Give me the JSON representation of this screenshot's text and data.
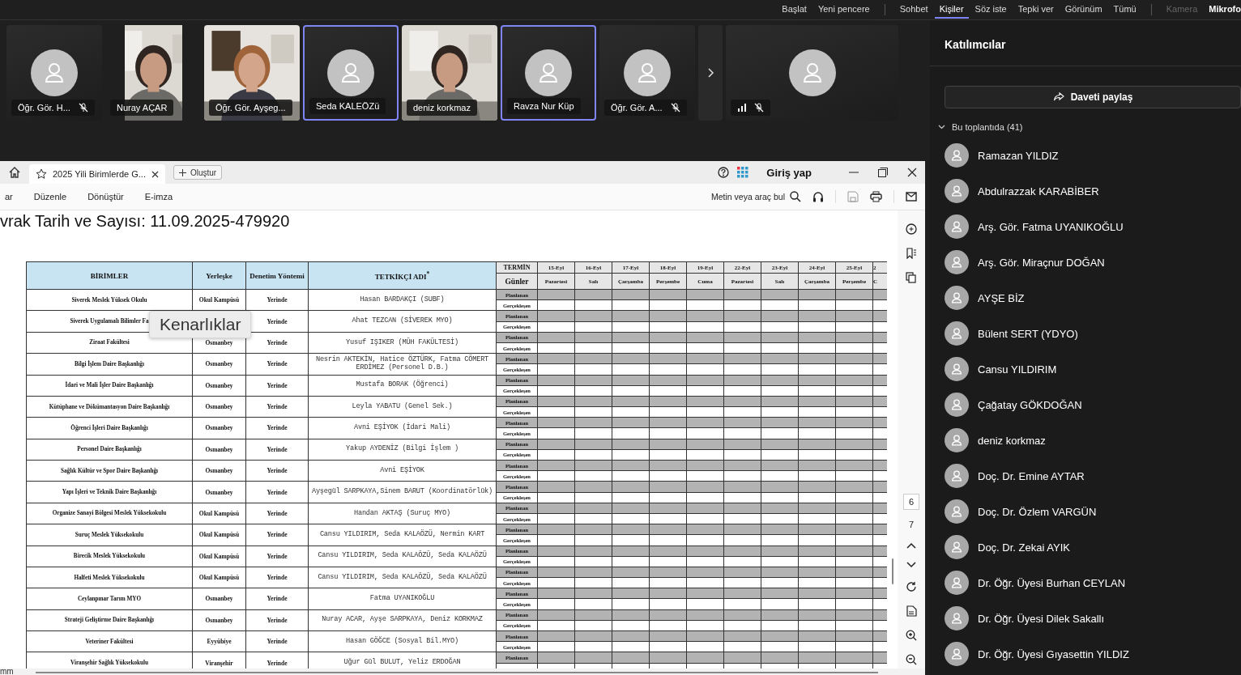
{
  "top_menu": [
    [
      {
        "label": "Başlat",
        "selected": false,
        "disabled": false
      },
      {
        "label": "Yeni pencere",
        "selected": false,
        "disabled": false
      }
    ],
    [
      {
        "label": "Sohbet",
        "selected": false,
        "disabled": false
      },
      {
        "label": "Kişiler",
        "selected": true,
        "disabled": false
      },
      {
        "label": "Söz iste",
        "selected": false,
        "disabled": false
      },
      {
        "label": "Tepki ver",
        "selected": false,
        "disabled": false
      },
      {
        "label": "Görünüm",
        "selected": false,
        "disabled": false
      },
      {
        "label": "Tümü",
        "selected": false,
        "disabled": false
      }
    ],
    [
      {
        "label": "Kamera",
        "selected": false,
        "disabled": true
      },
      {
        "label": "Mikrofo",
        "selected": false,
        "disabled": false
      }
    ]
  ],
  "video_tiles": [
    {
      "kind": "avatar",
      "name": "Öğr. Gör. H...",
      "muted": true,
      "highlighted": false,
      "connection_icon": false
    },
    {
      "kind": "portrait",
      "name": "Nuray AÇAR",
      "muted": false,
      "highlighted": false,
      "connection_icon": false
    },
    {
      "name": "Öğr. Gör. Ayşeg...",
      "muted": false,
      "highlighted": false,
      "connection_icon": false
    },
    {
      "kind": "avatar",
      "name": "Seda KALEÖZü",
      "muted": false,
      "highlighted": true,
      "connection_icon": false
    },
    {
      "name": "deniz korkmaz",
      "muted": false,
      "highlighted": false,
      "connection_icon": false
    },
    {
      "kind": "avatar",
      "name": "Ravza Nur Küp",
      "muted": false,
      "highlighted": true,
      "connection_icon": false
    },
    {
      "kind": "avatar",
      "name": "Öğr. Gör. A...",
      "muted": true,
      "highlighted": false,
      "connection_icon": false
    },
    {
      "kind": "wide",
      "muted": true,
      "highlighted": false,
      "connection_icon": true
    }
  ],
  "pdf": {
    "tab": {
      "title": "2025 Yili Birimlerde G...",
      "new_button": "Oluştur"
    },
    "sign_in": "Giriş yap",
    "toolbar": [
      "ar",
      "Düzenle",
      "Dönüştür",
      "E-imza"
    ],
    "search_label": "Metin veya araç bul",
    "heading": "vrak Tarih ve Sayısı: 11.09.2025-479920",
    "tooltip": "Kenarlıklar",
    "pages": [
      "6",
      "7"
    ],
    "status": "mm",
    "table": {
      "columns": [
        "BİRİMLER",
        "Yerleşke",
        "Denetim Yöntemi",
        "TETKİKÇİ ADI$^{*}$"
      ],
      "termin": "TERMİN",
      "days_label": "Günler",
      "dates": [
        {
          "date": "15-Eyl",
          "day": "Pazartesi"
        },
        {
          "date": "16-Eyl",
          "day": "Salı"
        },
        {
          "date": "17-Eyl",
          "day": "Çarşamba"
        },
        {
          "date": "18-Eyl",
          "day": "Perşembe"
        },
        {
          "date": "19-Eyl",
          "day": "Cuma"
        },
        {
          "date": "22-Eyl",
          "day": "Pazartesi"
        },
        {
          "date": "23-Eyl",
          "day": "Salı"
        },
        {
          "date": "24-Eyl",
          "day": "Çarşamba"
        },
        {
          "date": "25-Eyl",
          "day": "Perşembe"
        },
        {
          "date": "2",
          "day": "C"
        }
      ],
      "rows": [
        {
          "unit": "Siverek Meslek Yüksek Okulu",
          "campus": "Okul Kampüsü",
          "method": "Yerinde",
          "auditor": "Hasan BARDAKÇI (SUBF)",
          "planned": "Planlanan",
          "actual": "Gerçekleşen"
        },
        {
          "unit": "Siverek Uygulamalı Bilimler Fa",
          "method": "Yerinde",
          "auditor": "Ahat TEZCAN (SİVEREK MYO)",
          "planned": "Planlanan",
          "actual": "Gerçekleşen"
        },
        {
          "unit": "Ziraat Fakültesi",
          "campus": "Osmanbey",
          "method": "Yerinde",
          "auditor": "Yusuf IŞIKER (MÜH FAKÜLTESİ)",
          "planned": "Planlanan",
          "actual": "Gerçekleşen"
        },
        {
          "unit": "Bilgi İşlem Daire Başkanlığı",
          "campus": "Osmanbey",
          "method": "Yerinde",
          "auditor": "Nesrin AKTEKİN, Hatice ÖZTÜRK, Fatma CÖMERT ERDİMEZ (Personel D.B.)",
          "planned": "Planlanan",
          "actual": "Gerçekleşen"
        },
        {
          "unit": "İdari ve Mali İşler Daire Başkanlığı",
          "campus": "Osmanbey",
          "method": "Yerinde",
          "auditor": "Mustafa BORAK (Öğrenci)",
          "planned": "Planlanan",
          "actual": "Gerçekleşen"
        },
        {
          "unit": "Kütüphane ve Dökümantasyon Daire Başkanlığı",
          "campus": "Osmanbey",
          "method": "Yerinde",
          "auditor": "Leyla YABATU (Genel Sek.)",
          "planned": "Planlanan",
          "actual": "Gerçekleşen"
        },
        {
          "unit": "Öğrenci İşleri Daire Başkanlığı",
          "campus": "Osmanbey",
          "method": "Yerinde",
          "auditor": "Avni EŞİYOK (İdari Mali)",
          "planned": "Planlanan",
          "actual": "Gerçekleşen"
        },
        {
          "unit": "Personel Daire Başkanlığı",
          "campus": "Osmanbey",
          "method": "Yerinde",
          "auditor": "Yakup AYDENİZ (Bilgi İşlem )",
          "planned": "Planlanan",
          "actual": "Gerçekleşen"
        },
        {
          "unit": "Sağlık Kültür ve Spor Daire Başkanlığı",
          "campus": "Osmanbey",
          "method": "Yerinde",
          "auditor": "Avni EŞİYOK",
          "planned": "Planlanan",
          "actual": "Gerçekleşen"
        },
        {
          "unit": "Yapı İşleri ve Teknik Daire Başkanlığı",
          "campus": "Osmanbey",
          "method": "Yerinde",
          "auditor": "Ayşegül SARPKAYA,Sinem BARUT (Koordinatörlük)",
          "planned": "Planlanan",
          "actual": "Gerçekleşen"
        },
        {
          "unit": "Organize Sanayi Bölgesi Meslek Yüksekokulu",
          "campus": "Okul Kampüsü",
          "method": "Yerinde",
          "auditor": "Handan AKTAŞ (Suruç MYO)",
          "planned": "Planlanan",
          "actual": "Gerçekleşen"
        },
        {
          "unit": "Suruç Meslek Yüksekokulu",
          "campus": "Okul Kampüsü",
          "method": "Yerinde",
          "auditor": "Cansu YILDIRIM, Seda KALAÖZÜ, Nermin KART",
          "planned": "Planlanan",
          "actual": "Gerçekleşen"
        },
        {
          "unit": "Birecik Meslek Yüksekokulu",
          "campus": "Okul Kampüsü",
          "method": "Yerinde",
          "auditor": "Cansu YILDIRIM, Seda KALAÖZÜ, Seda KALAÖZÜ",
          "planned": "Planlanan",
          "actual": "Gerçekleşen"
        },
        {
          "unit": "Halfeti Meslek Yüksekokulu",
          "campus": "Okul Kampüsü",
          "method": "Yerinde",
          "auditor": "Cansu YILDIRIM, Seda KALAÖZÜ, Seda KALAÖZÜ",
          "planned": "Planlanan",
          "actual": "Gerçekleşen"
        },
        {
          "unit": "Ceylanpınar Tarım MYO",
          "campus": "Osmanbey",
          "method": "Yerinde",
          "auditor": "Fatma UYANIKOĞLU",
          "planned": "Planlanan",
          "actual": "Gerçekleşen"
        },
        {
          "unit": "Strateji Geliştirme Daire Başkanlığı",
          "campus": "Osmanbey",
          "method": "Yerinde",
          "auditor": "Nuray ACAR, Ayşe SARPKAYA, Deniz KORKMAZ",
          "planned": "Planlanan",
          "actual": "Gerçekleşen"
        },
        {
          "unit": "Veteriner Fakültesi",
          "campus": "Eyyübiye",
          "method": "Yerinde",
          "auditor": "Hasan GÖĞCE (Sosyal Bil.MYO)",
          "planned": "Planlanan",
          "actual": "Gerçekleşen"
        },
        {
          "unit": "Viranşehir Sağlık Yüksekokulu",
          "campus": "Viranşehir",
          "method": "Yerinde",
          "auditor": "Uğur Gül BULUT, Yeliz ERDOĞAN",
          "planned": "Planlanan"
        }
      ]
    }
  },
  "participants_panel": {
    "title": "Katılımcılar",
    "share_button": "Daveti paylaş",
    "section": "Bu toplantıda (41)",
    "people": [
      "Ramazan YILDIZ",
      "Abdulrazzak KARABİBER",
      "Arş. Gör. Fatma UYANIKOĞLU",
      "Arş. Gör. Miraçnur DOĞAN",
      "AYŞE BİZ",
      "Bülent SERT (YDYO)",
      "Cansu YILDIRIM",
      "Çağatay GÖKDOĞAN",
      "deniz korkmaz",
      "Doç. Dr. Emine AYTAR",
      "Doç. Dr. Özlem VARGÜN",
      "Doç. Dr. Zekai AYIK",
      "Dr. Öğr. Üyesi Burhan CEYLAN",
      "Dr. Öğr. Üyesi Dilek Sakallı",
      "Dr. Öğr. Üyesi Gıyasettin YILDIZ"
    ]
  }
}
